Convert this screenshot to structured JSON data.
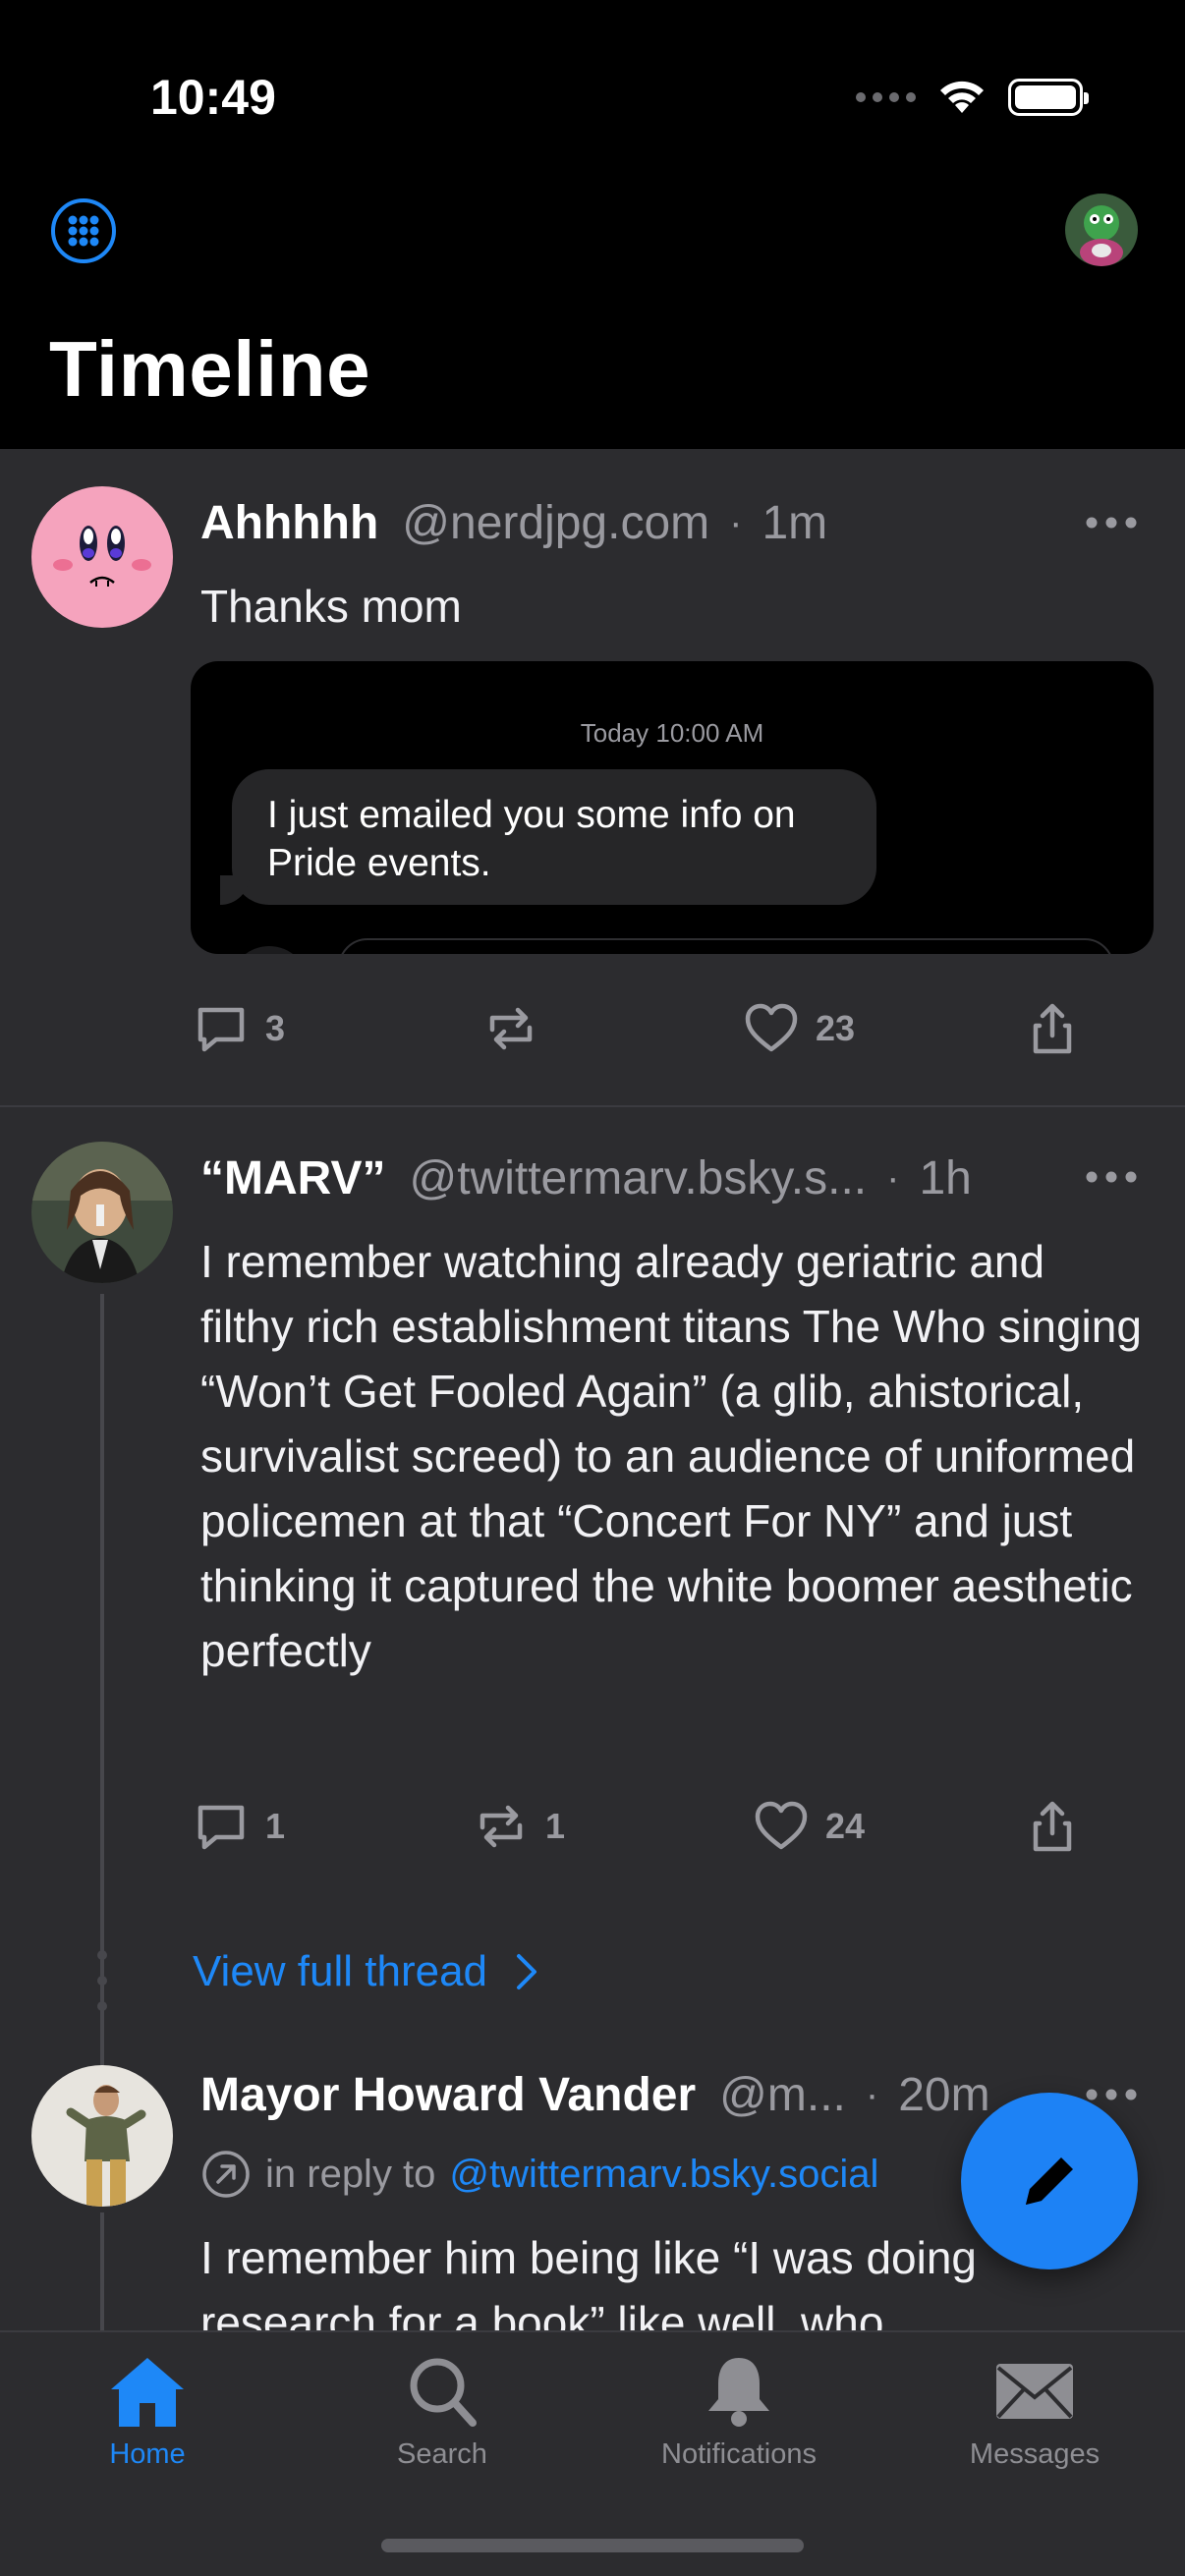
{
  "status_bar": {
    "time": "10:49"
  },
  "header": {
    "title": "Timeline",
    "menu_icon": "apps-grid-icon",
    "profile_icon": "profile-avatar"
  },
  "posts": [
    {
      "author": "Ahhhhh",
      "handle": "@nerdjpg.com",
      "time": "1m",
      "text": "Thanks mom",
      "embed": {
        "timestamp": "Today 10:00 AM",
        "message": "I just emailed you some info on Pride events."
      },
      "replies": "3",
      "reposts": "",
      "likes": "23"
    },
    {
      "author": "“MARV”",
      "handle": "@twittermarv.bsky.s...",
      "time": "1h",
      "text": "I remember watching already geriatric and filthy rich establishment titans The Who singing “Won’t Get Fooled Again” (a glib, ahistorical, survivalist screed) to an audience of uniformed policemen at that “Concert For NY” and just thinking it captured the white boomer aesthetic perfectly",
      "replies": "1",
      "reposts": "1",
      "likes": "24"
    },
    {
      "author": "Mayor Howard Vander",
      "handle": "@m...",
      "time": "20m",
      "reply_prefix": "in reply to",
      "reply_to": "@twittermarv.bsky.social",
      "text": "I remember him being like “I was doing research for a book” like well, who"
    }
  ],
  "view_full_thread": "View full thread",
  "tabs": [
    {
      "label": "Home",
      "icon": "home-icon",
      "active": true
    },
    {
      "label": "Search",
      "icon": "search-icon",
      "active": false
    },
    {
      "label": "Notifications",
      "icon": "bell-icon",
      "active": false
    },
    {
      "label": "Messages",
      "icon": "envelope-icon",
      "active": false
    }
  ],
  "colors": {
    "accent": "#1e88f7",
    "background": "#2c2c2f",
    "header": "#000000",
    "secondary_text": "#9a9aa0"
  }
}
